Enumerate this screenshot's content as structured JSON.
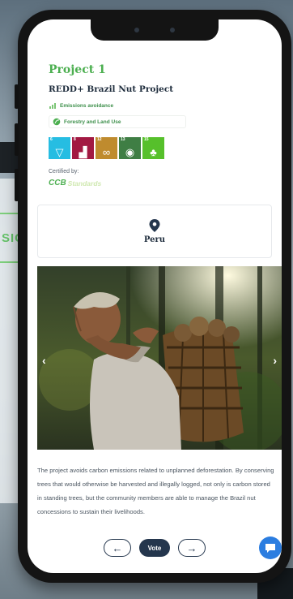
{
  "background": {
    "side_label": "SIC"
  },
  "project": {
    "label": "Project 1",
    "name": "REDD+ Brazil Nut Project",
    "tags": [
      "Emissions avoidance",
      "Forestry and Land Use"
    ],
    "sdgs": [
      {
        "number": "6",
        "color": "#26bde2",
        "icon": "clean-water-icon",
        "glyph": "▽"
      },
      {
        "number": "8",
        "color": "#a21942",
        "icon": "economic-growth-icon",
        "glyph": "▟"
      },
      {
        "number": "12",
        "color": "#bf8b2e",
        "icon": "responsible-consumption-icon",
        "glyph": "∞"
      },
      {
        "number": "13",
        "color": "#3f7e44",
        "icon": "climate-action-icon",
        "glyph": "◉"
      },
      {
        "number": "15",
        "color": "#56c02b",
        "icon": "life-on-land-icon",
        "glyph": "♣"
      }
    ],
    "certified_label": "Certified by:",
    "certifier": {
      "mark": "CCB",
      "name": "Standards"
    },
    "location": "Peru",
    "description": "The project avoids carbon emissions related to unplanned deforestation. By conserving trees that would otherwise be harvested and illegally logged, not only is carbon stored in standing trees, but the community members are able to manage the Brazil nut concessions to sustain their livelihoods."
  },
  "carousel": {
    "prev": "‹",
    "next": "›"
  },
  "nav": {
    "prev": "←",
    "vote": "Vote",
    "next": "→"
  },
  "colors": {
    "accent_green": "#4caf50",
    "navy": "#24364d",
    "chat_blue": "#2b7de0"
  }
}
